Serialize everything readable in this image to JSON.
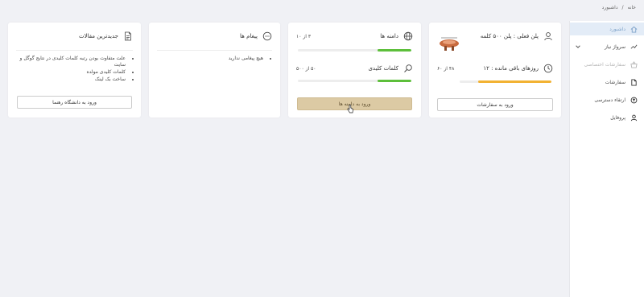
{
  "breadcrumb": {
    "home": "خانه",
    "separator": "/",
    "current": "داشبورد"
  },
  "sidebar": {
    "items": [
      {
        "label": "داشبورد",
        "icon": "home-icon",
        "state": "active"
      },
      {
        "label": "سرواژ نیاز",
        "icon": "trend-icon",
        "state": "normal"
      },
      {
        "label": "سفارشات اختصاصی",
        "icon": "basket-icon",
        "state": "disabled"
      },
      {
        "label": "سفارشات",
        "icon": "file-icon",
        "state": "normal"
      },
      {
        "label": "ارتقاء دسترسی",
        "icon": "upgrade-icon",
        "state": "normal"
      },
      {
        "label": "پروفایل",
        "icon": "user-icon",
        "state": "normal"
      }
    ]
  },
  "cards": {
    "plan": {
      "title": "پلن فعلی : پلن ۵۰۰ کلمه",
      "days_label": "روزهای باقی مانده : ۱۲",
      "days_count": "۴۸ از ۶۰",
      "days_progress": 0.8,
      "button": "ورود به سفارشات"
    },
    "usage": {
      "domains_label": "دامنه ها",
      "domains_count": "۳ از ۱۰",
      "domains_progress": 0.3,
      "keywords_label": "کلمات کلیدی",
      "keywords_count": "۵۰ از ۵۰۰",
      "keywords_progress": 0.3,
      "button": "ورود به دامنه ها"
    },
    "messages": {
      "title": "پیغام ها",
      "empty": "هیچ پیغامی ندارید"
    },
    "articles": {
      "title": "جدیدترین مقالات",
      "items": [
        "علت متفاوت بودن رتبه کلمات کلیدی در نتایج گوگل و سایت",
        "کلمات کلیدی مولده",
        "ساخت بک لینک"
      ],
      "button": "ورود به دانشگاه رهنما"
    }
  },
  "colors": {
    "accent_gold": "#dccaa4",
    "progress_green": "#5dbf3b",
    "progress_orange": "#f2b233",
    "sidebar_active": "#e3ecf7"
  }
}
